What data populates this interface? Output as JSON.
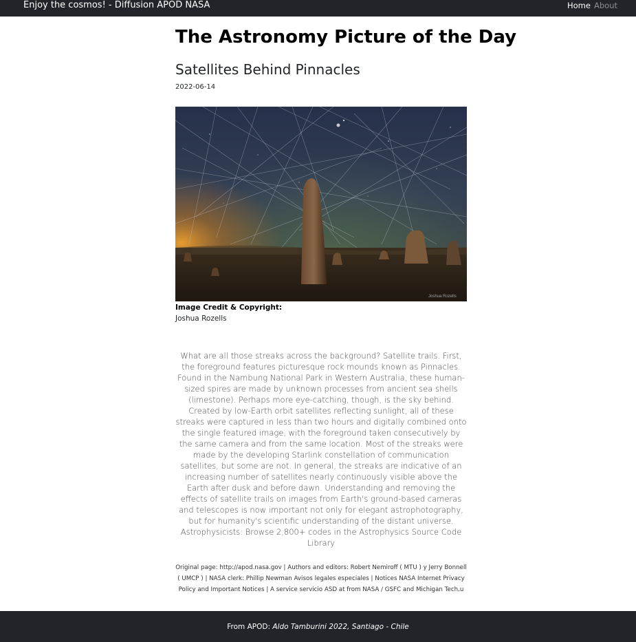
{
  "navbar": {
    "brand": "Enjoy the cosmos! - Diffusion APOD NASA",
    "home": "Home",
    "about": "About"
  },
  "main": {
    "page_title": "The Astronomy Picture of the Day",
    "apod_title": "Satellites Behind Pinnacles",
    "date": "2022-06-14",
    "image": {
      "watermark": "Joshua Rozells"
    },
    "credit_label": "Image Credit & Copyright:",
    "credit_name": "Joshua Rozells",
    "explanation": "What are all those streaks across the background? Satellite trails. First, the foreground features picturesque rock mounds known as Pinnacles. Found in the Nambung National Park in Western Australia, these human-sized spires are made by unknown processes from ancient sea shells (limestone). Perhaps more eye-catching, though, is the sky behind. Created by low-Earth orbit satellites reflecting sunlight, all of these streaks were captured in less than two hours and digitally combined onto the single featured image, with the foreground taken consecutively by the same camera and from the same location. Most of the streaks were made by the developing Starlink constellation of communication satellites, but some are not. In general, the streaks are indicative of an increasing number of satellites nearly continuously visible above the Earth after dusk and before dawn. Understanding and removing the effects of satellite trails on images from Earth's ground-based cameras and telescopes is now important not only for elegant astrophotography, but for humanity's scientific understanding of the distant universe. Astrophysicists: Browse 2,800+ codes in the Astrophysics Source Code Library",
    "original_page": "Original page: http://apod.nasa.gov | Authors and editors: Robert Nemiroff ( MTU ) y Jerry Bonnell ( UMCP ) | NASA clerk: Phillip Newman Avisos legales especiales | Notices NASA Internet Privacy Policy and Important Notices | A service servicio ASD at from NASA / GSFC and Michigan Tech.u"
  },
  "footer": {
    "prefix": "From APOD:",
    "credit": "Aldo Tamburini 2022, Santiago - Chile"
  }
}
